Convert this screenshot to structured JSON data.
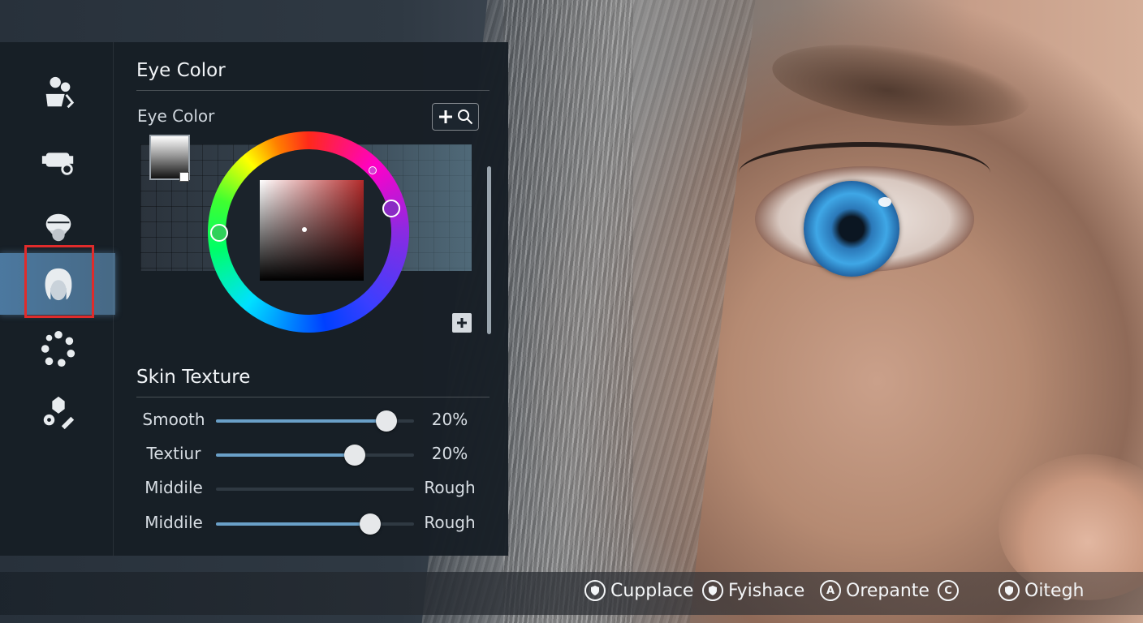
{
  "sidebar": {
    "items": [
      {
        "icon": "character-profile-icon"
      },
      {
        "icon": "body-settings-icon"
      },
      {
        "icon": "head-shape-icon"
      },
      {
        "icon": "face-hair-icon",
        "active": true
      },
      {
        "icon": "features-ring-icon"
      },
      {
        "icon": "advanced-settings-icon"
      }
    ]
  },
  "eye_color": {
    "section_title": "Eye Color",
    "picker_label": "Eye Color",
    "zoom_icon": "zoom-in-icon",
    "add_icon": "add-icon"
  },
  "skin_texture": {
    "section_title": "Skin Texture",
    "sliders": [
      {
        "label": "Smooth",
        "value_label": "20%",
        "fill": 0.86
      },
      {
        "label": "Textiur",
        "value_label": "20%",
        "fill": 0.7
      },
      {
        "label": "Middile",
        "value_label": "Rough",
        "fill": null
      },
      {
        "label": "Middile",
        "value_label": "Rough",
        "fill": 0.78
      }
    ]
  },
  "bottom_bar": {
    "hints": [
      {
        "button": "shield",
        "label": "Cupplace"
      },
      {
        "button": "shield",
        "label": "Fyishace"
      },
      {
        "button": "A",
        "label": "Orepante"
      },
      {
        "button": "C",
        "label": ""
      },
      {
        "button": "shield",
        "label": "Oitegh"
      }
    ]
  },
  "colors": {
    "panel_bg": "#171e25",
    "accent_blue": "#6aa0c8",
    "active_frame": "#e02b2b"
  }
}
